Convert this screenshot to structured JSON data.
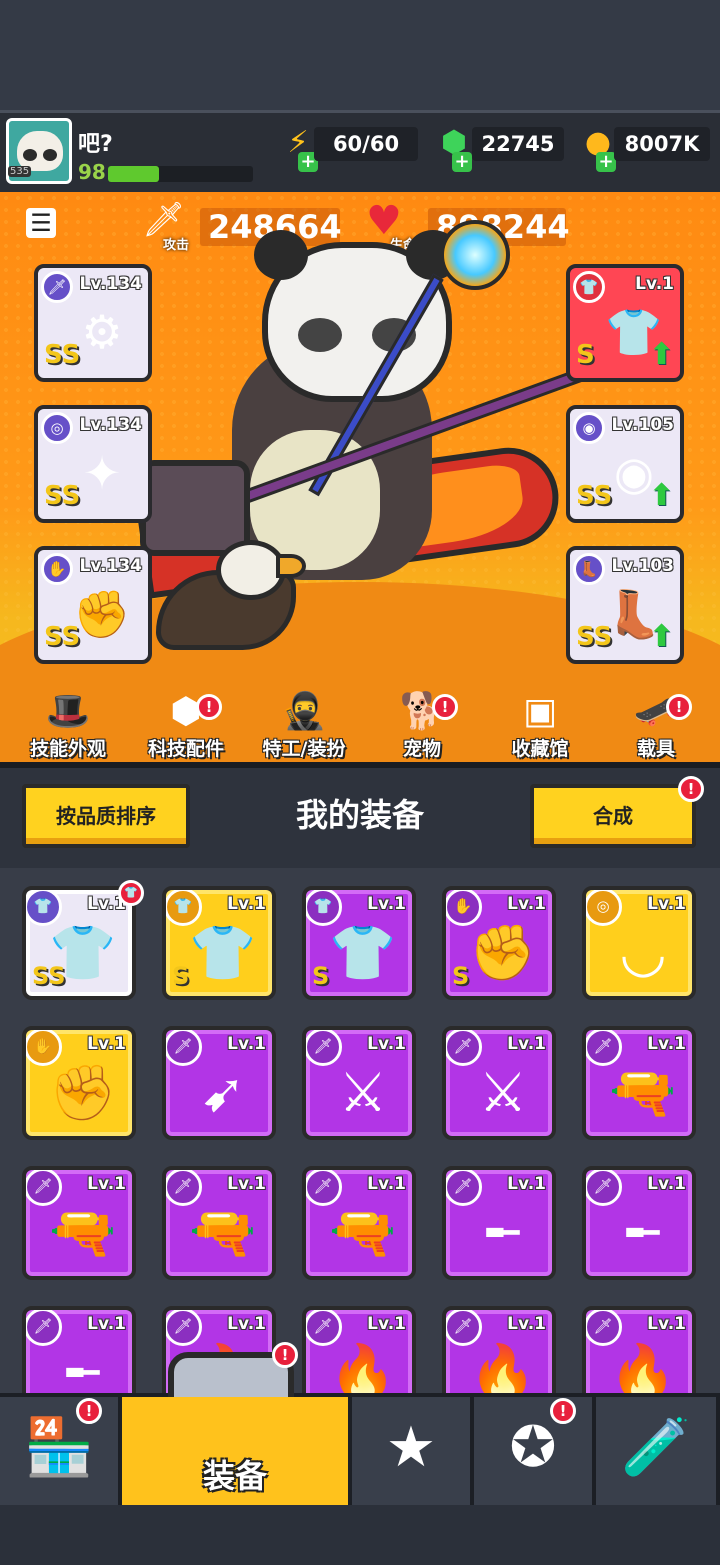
{
  "player": {
    "name": "吧?",
    "level": "98",
    "avatar_badge": "535",
    "xp_fraction": 0.35
  },
  "resources": {
    "energy": "60/60",
    "gems": "22745",
    "gold": "8007K"
  },
  "stats": {
    "attack_label": "攻击",
    "attack_value": "248664",
    "hp_label": "生命",
    "hp_value": "898244"
  },
  "equipped_left": [
    {
      "level": "Lv.134",
      "rank": "SS",
      "category_icon": "weapon-icon",
      "art_icon": "staff-icon"
    },
    {
      "level": "Lv.134",
      "rank": "SS",
      "category_icon": "necklace-icon",
      "art_icon": "collar-icon"
    },
    {
      "level": "Lv.134",
      "rank": "SS",
      "category_icon": "glove-icon",
      "art_icon": "gauntlet-icon"
    }
  ],
  "equipped_right": [
    {
      "level": "Lv.1",
      "rank": "S",
      "category_icon": "armor-icon",
      "art_icon": "armor-icon",
      "upgrade": true
    },
    {
      "level": "Lv.105",
      "rank": "SS",
      "category_icon": "belt-icon",
      "art_icon": "belt-icon",
      "upgrade": true
    },
    {
      "level": "Lv.103",
      "rank": "SS",
      "category_icon": "boot-icon",
      "art_icon": "boot-icon",
      "upgrade": true
    }
  ],
  "feature_nav": [
    {
      "label": "技能外观",
      "icon": "skill-skin-icon",
      "alert": false
    },
    {
      "label": "科技配件",
      "icon": "tech-parts-icon",
      "alert": true
    },
    {
      "label": "特工/装扮",
      "icon": "agent-icon",
      "alert": false
    },
    {
      "label": "宠物",
      "icon": "pet-icon",
      "alert": true
    },
    {
      "label": "收藏馆",
      "icon": "collection-icon",
      "alert": false
    },
    {
      "label": "载具",
      "icon": "vehicle-icon",
      "alert": true
    }
  ],
  "inventory_header": {
    "sort_button": "按品质排序",
    "title": "我的装备",
    "merge_button": "合成"
  },
  "inventory": [
    {
      "level": "Lv.1",
      "rarity": "white",
      "rank": "SS",
      "category_icon": "armor-icon",
      "art_icon": "armor-icon"
    },
    {
      "level": "Lv.1",
      "rarity": "gold",
      "rank": "S",
      "category_icon": "armor-icon",
      "art_icon": "armor-icon"
    },
    {
      "level": "Lv.1",
      "rarity": "purple",
      "rank": "S",
      "category_icon": "armor-icon",
      "art_icon": "armor-icon"
    },
    {
      "level": "Lv.1",
      "rarity": "purple",
      "rank": "S",
      "category_icon": "glove-icon",
      "art_icon": "gauntlet-icon"
    },
    {
      "level": "Lv.1",
      "rarity": "gold",
      "rank": "",
      "category_icon": "necklace-icon",
      "art_icon": "fang-necklace-icon"
    },
    {
      "level": "Lv.1",
      "rarity": "gold",
      "rank": "",
      "category_icon": "glove-icon",
      "art_icon": "gauntlet-icon"
    },
    {
      "level": "Lv.1",
      "rarity": "purple",
      "rank": "",
      "category_icon": "weapon-icon",
      "art_icon": "kunai-icon"
    },
    {
      "level": "Lv.1",
      "rarity": "purple",
      "rank": "",
      "category_icon": "weapon-icon",
      "art_icon": "katana-icon"
    },
    {
      "level": "Lv.1",
      "rarity": "purple",
      "rank": "",
      "category_icon": "weapon-icon",
      "art_icon": "katana-icon"
    },
    {
      "level": "Lv.1",
      "rarity": "purple",
      "rank": "",
      "category_icon": "weapon-icon",
      "art_icon": "revolver-icon"
    },
    {
      "level": "Lv.1",
      "rarity": "purple",
      "rank": "",
      "category_icon": "weapon-icon",
      "art_icon": "revolver-icon"
    },
    {
      "level": "Lv.1",
      "rarity": "purple",
      "rank": "",
      "category_icon": "weapon-icon",
      "art_icon": "revolver-icon"
    },
    {
      "level": "Lv.1",
      "rarity": "purple",
      "rank": "",
      "category_icon": "weapon-icon",
      "art_icon": "revolver-icon"
    },
    {
      "level": "Lv.1",
      "rarity": "purple",
      "rank": "",
      "category_icon": "weapon-icon",
      "art_icon": "shotgun-icon"
    },
    {
      "level": "Lv.1",
      "rarity": "purple",
      "rank": "",
      "category_icon": "weapon-icon",
      "art_icon": "shotgun-icon"
    },
    {
      "level": "Lv.1",
      "rarity": "purple",
      "rank": "",
      "category_icon": "weapon-icon",
      "art_icon": "shotgun-icon"
    },
    {
      "level": "Lv.1",
      "rarity": "purple",
      "rank": "",
      "category_icon": "weapon-icon",
      "art_icon": "torch-icon"
    },
    {
      "level": "Lv.1",
      "rarity": "purple",
      "rank": "",
      "category_icon": "weapon-icon",
      "art_icon": "torch-icon"
    },
    {
      "level": "Lv.1",
      "rarity": "purple",
      "rank": "",
      "category_icon": "weapon-icon",
      "art_icon": "torch-icon"
    },
    {
      "level": "Lv.1",
      "rarity": "purple",
      "rank": "",
      "category_icon": "weapon-icon",
      "art_icon": "torch-icon"
    }
  ],
  "bottom_tabs": [
    {
      "label": "",
      "icon": "shop-icon",
      "alert": true,
      "active": false
    },
    {
      "label": "装备",
      "icon": "equipment-icon",
      "alert": true,
      "active": true
    },
    {
      "label": "",
      "icon": "battle-star-icon",
      "alert": false,
      "active": false
    },
    {
      "label": "",
      "icon": "skill-orb-icon",
      "alert": true,
      "active": false
    },
    {
      "label": "",
      "icon": "gene-tube-icon",
      "alert": false,
      "active": false
    }
  ],
  "colors": {
    "stage_orange": "#ff8a12",
    "rarity_purple": "#b235e6",
    "rarity_gold": "#ffcf1c",
    "rarity_white": "#ece8f6",
    "alert_red": "#e8203c",
    "button_yellow": "#ffd21f",
    "upgrade_green": "#2ec940"
  }
}
